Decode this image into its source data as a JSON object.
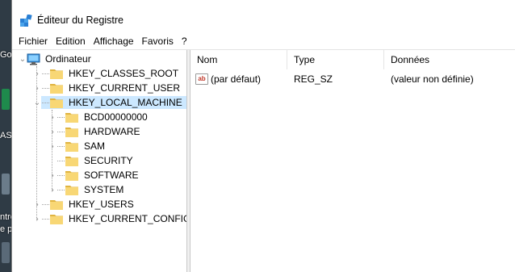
{
  "window": {
    "title": "Éditeur du Registre"
  },
  "menu": [
    "Fichier",
    "Edition",
    "Affichage",
    "Favoris",
    "?"
  ],
  "tree": {
    "root": "Ordinateur",
    "hives": [
      {
        "label": "HKEY_CLASSES_ROOT",
        "expanded": false
      },
      {
        "label": "HKEY_CURRENT_USER",
        "expanded": false
      },
      {
        "label": "HKEY_LOCAL_MACHINE",
        "expanded": true,
        "selected": true
      },
      {
        "label": "HKEY_USERS",
        "expanded": false
      },
      {
        "label": "HKEY_CURRENT_CONFIG",
        "expanded": false
      }
    ],
    "hklm_children": [
      {
        "label": "BCD00000000",
        "has_children": true
      },
      {
        "label": "HARDWARE",
        "has_children": true
      },
      {
        "label": "SAM",
        "has_children": true
      },
      {
        "label": "SECURITY",
        "has_children": false
      },
      {
        "label": "SOFTWARE",
        "has_children": true
      },
      {
        "label": "SYSTEM",
        "has_children": true
      }
    ]
  },
  "list": {
    "columns": [
      "Nom",
      "Type",
      "Données"
    ],
    "rows": [
      {
        "icon": "string-value-icon",
        "icon_text": "ab",
        "name": "(par défaut)",
        "type": "REG_SZ",
        "data": "(valeur non définie)"
      }
    ]
  },
  "desktop": {
    "fragments": [
      "Go",
      "AS",
      "ntre",
      "e p"
    ]
  },
  "colors": {
    "selection": "#cce8ff",
    "folder": "#f8d775",
    "folder_dark": "#e0b441"
  }
}
